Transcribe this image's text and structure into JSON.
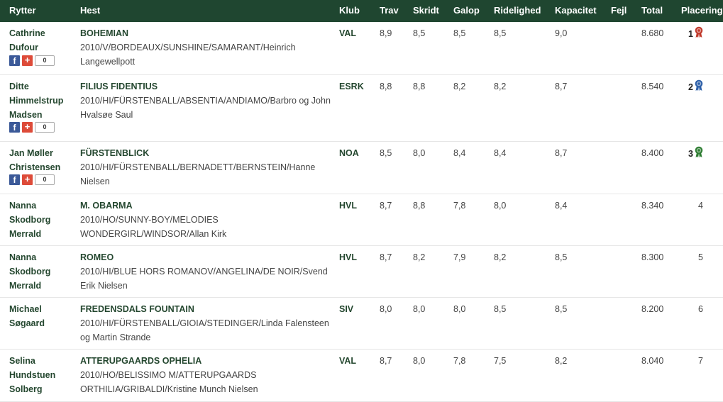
{
  "header": {
    "rytter": "Rytter",
    "hest": "Hest",
    "klub": "Klub",
    "trav": "Trav",
    "skridt": "Skridt",
    "galop": "Galop",
    "ridelighed": "Ridelighed",
    "kapacitet": "Kapacitet",
    "fejl": "Fejl",
    "total": "Total",
    "placering": "Placering"
  },
  "colors": {
    "header_bg": "#1f4630",
    "rosette_1": "#c0392b",
    "rosette_2": "#2c5fa8",
    "rosette_3": "#2e7d32"
  },
  "rows": [
    {
      "rider": [
        "Cathrine",
        "Dufour"
      ],
      "horse_name": "BOHEMIAN",
      "horse_info": "2010/V/BORDEAUX/SUNSHINE/SAMARANT/Heinrich Langewellpott",
      "klub": "VAL",
      "trav": "8,9",
      "skridt": "8,5",
      "galop": "8,5",
      "ridelighed": "8,5",
      "kapacitet": "9,0",
      "fejl": "",
      "total": "8.680",
      "placering": "1",
      "share": {
        "fb": "f",
        "gplus": "+",
        "count": "0"
      },
      "rosette": "red-rosette-icon"
    },
    {
      "rider": [
        "Ditte",
        "Himmelstrup",
        "Madsen"
      ],
      "horse_name": "FILIUS FIDENTIUS",
      "horse_info": "2010/HI/FÜRSTENBALL/ABSENTIA/ANDIAMO/Barbro og John Hvalsøe Saul",
      "klub": "ESRK",
      "trav": "8,8",
      "skridt": "8,8",
      "galop": "8,2",
      "ridelighed": "8,2",
      "kapacitet": "8,7",
      "fejl": "",
      "total": "8.540",
      "placering": "2",
      "share": {
        "fb": "f",
        "gplus": "+",
        "count": "0"
      },
      "rosette": "blue-rosette-icon"
    },
    {
      "rider": [
        "Jan Møller",
        "Christensen"
      ],
      "horse_name": "FÜRSTENBLICK",
      "horse_info": "2010/HI/FÜRSTENBALL/BERNADETT/BERNSTEIN/Hanne Nielsen",
      "klub": "NOA",
      "trav": "8,5",
      "skridt": "8,0",
      "galop": "8,4",
      "ridelighed": "8,4",
      "kapacitet": "8,7",
      "fejl": "",
      "total": "8.400",
      "placering": "3",
      "share": {
        "fb": "f",
        "gplus": "+",
        "count": "0"
      },
      "rosette": "green-rosette-icon"
    },
    {
      "rider": [
        "Nanna",
        "Skodborg",
        "Merrald"
      ],
      "horse_name": "M. OBARMA",
      "horse_info": "2010/HO/SUNNY-BOY/MELODIES WONDERGIRL/WINDSOR/Allan Kirk",
      "klub": "HVL",
      "trav": "8,7",
      "skridt": "8,8",
      "galop": "7,8",
      "ridelighed": "8,0",
      "kapacitet": "8,4",
      "fejl": "",
      "total": "8.340",
      "placering": "4"
    },
    {
      "rider": [
        "Nanna",
        "Skodborg",
        "Merrald"
      ],
      "horse_name": "ROMEO",
      "horse_info": "2010/HI/BLUE HORS ROMANOV/ANGELINA/DE NOIR/Svend Erik Nielsen",
      "klub": "HVL",
      "trav": "8,7",
      "skridt": "8,2",
      "galop": "7,9",
      "ridelighed": "8,2",
      "kapacitet": "8,5",
      "fejl": "",
      "total": "8.300",
      "placering": "5"
    },
    {
      "rider": [
        "Michael",
        "Søgaard"
      ],
      "horse_name": "FREDENSDALS FOUNTAIN",
      "horse_info": "2010/HI/FÜRSTENBALL/GIOIA/STEDINGER/Linda Falensteen og Martin Strande",
      "klub": "SIV",
      "trav": "8,0",
      "skridt": "8,0",
      "galop": "8,0",
      "ridelighed": "8,5",
      "kapacitet": "8,5",
      "fejl": "",
      "total": "8.200",
      "placering": "6"
    },
    {
      "rider": [
        "Selina",
        "Hundstuen",
        "Solberg"
      ],
      "horse_name": "ATTERUPGAARDS OPHELIA",
      "horse_info": "2010/HO/BELISSIMO M/ATTERUPGAARDS ORTHILIA/GRIBALDI/Kristine Munch Nielsen",
      "klub": "VAL",
      "trav": "8,7",
      "skridt": "8,0",
      "galop": "7,8",
      "ridelighed": "7,5",
      "kapacitet": "8,2",
      "fejl": "",
      "total": "8.040",
      "placering": "7"
    }
  ]
}
